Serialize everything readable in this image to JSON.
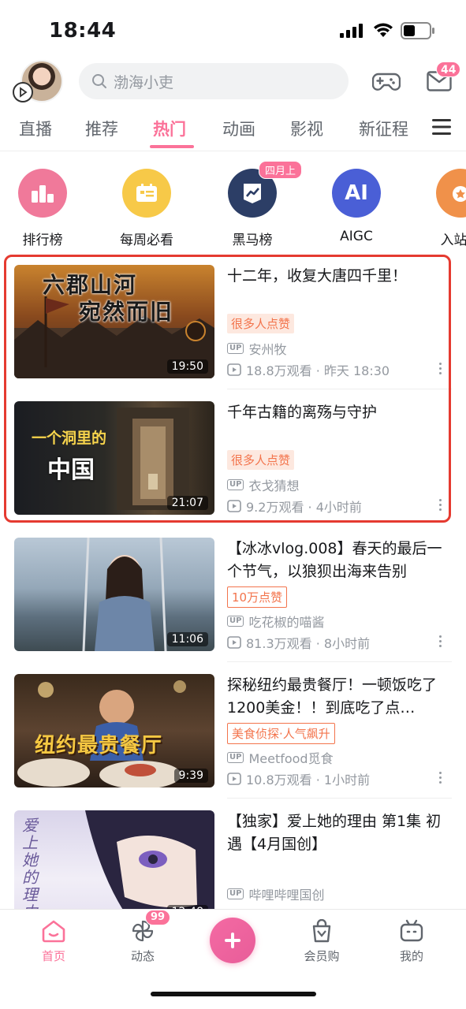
{
  "status_bar": {
    "time": "18:44"
  },
  "header": {
    "search_placeholder": "渤海小吏",
    "mail_badge": "44"
  },
  "tabs": [
    {
      "label": "直播"
    },
    {
      "label": "推荐"
    },
    {
      "label": "热门",
      "active": true
    },
    {
      "label": "动画"
    },
    {
      "label": "影视"
    },
    {
      "label": "新征程"
    }
  ],
  "quick_entries": [
    {
      "label": "排行榜",
      "icon": "ranking-icon",
      "color": "#f0799a"
    },
    {
      "label": "每周必看",
      "icon": "weekly-icon",
      "color": "#f7c948"
    },
    {
      "label": "黑马榜",
      "icon": "dark-horse-icon",
      "color": "#2c3e66",
      "badge": "四月上"
    },
    {
      "label": "AIGC",
      "icon": "ai-icon",
      "icon_text": "AI",
      "color": "#4a5fd6"
    },
    {
      "label": "入站必",
      "icon": "entry-icon",
      "color": "#f0914a"
    }
  ],
  "videos": [
    {
      "title": "十二年，收复大唐四千里！",
      "tag": "很多人点赞",
      "tag_style": "filled",
      "up": "安州牧",
      "stats": "18.8万观看 · 昨天 18:30",
      "duration": "19:50",
      "thumb_text": [
        "六郡山河",
        "宛然而旧"
      ]
    },
    {
      "title": "千年古籍的离殇与守护",
      "tag": "很多人点赞",
      "tag_style": "filled",
      "up": "衣戈猜想",
      "stats": "9.2万观看 · 4小时前",
      "duration": "21:07",
      "thumb_text": [
        "一个洞里的",
        "中国"
      ]
    },
    {
      "title": "【冰冰vlog.008】春天的最后一个节气，以狼狈出海来告别",
      "tag": "10万点赞",
      "tag_style": "outline",
      "up": "吃花椒的喵酱",
      "stats": "81.3万观看 · 8小时前",
      "duration": "11:06",
      "thumb_text": []
    },
    {
      "title": "探秘纽约最贵餐厅！一顿饭吃了1200美金！！到底吃了点…",
      "tag": "美食侦探·人气飙升",
      "tag_style": "outline",
      "up": "Meetfood觅食",
      "stats": "10.8万观看 · 1小时前",
      "duration": "9:39",
      "thumb_text": [
        "纽约最贵餐厅"
      ]
    },
    {
      "title": "【独家】爱上她的理由 第1集 初遇【4月国创】",
      "tag": "",
      "tag_style": "none",
      "up": "哔哩哔哩国创",
      "stats": "",
      "duration": "12:48",
      "thumb_text": [
        "爱上她的理由"
      ]
    }
  ],
  "bottom_nav": [
    {
      "label": "首页",
      "active": true
    },
    {
      "label": "动态",
      "badge": "99"
    },
    {
      "label": "",
      "icon": "plus-icon"
    },
    {
      "label": "会员购"
    },
    {
      "label": "我的"
    }
  ]
}
